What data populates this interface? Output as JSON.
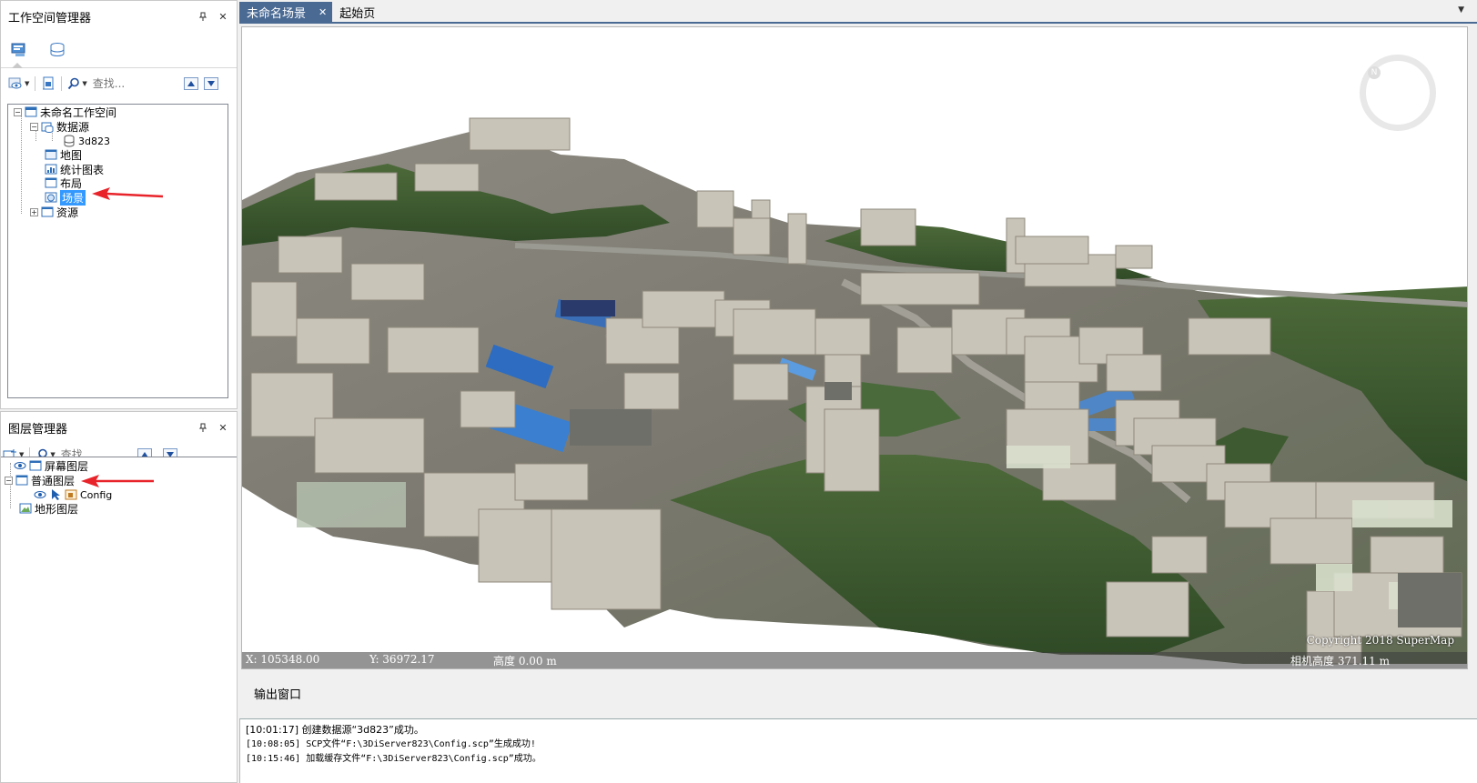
{
  "workspace_panel": {
    "title": "工作空间管理器",
    "pin": "ᴾ",
    "close": "✕",
    "search_placeholder": "查找...",
    "tree": {
      "root": "未命名工作空间",
      "datasources": "数据源",
      "datasource_item": "3d823",
      "map": "地图",
      "chart": "统计图表",
      "layout": "布局",
      "scene": "场景",
      "resources": "资源"
    }
  },
  "layer_panel": {
    "title": "图层管理器",
    "pin": "ᴾ",
    "close": "✕",
    "search_placeholder": "查找...",
    "tree": {
      "screen_layers": "屏幕图层",
      "normal_layers": "普通图层",
      "config_layer": "Config",
      "terrain_layers": "地形图层"
    }
  },
  "doc_tabs": {
    "active": "未命名场景",
    "close": "✕",
    "start_page": "起始页",
    "menu": "▼"
  },
  "scene": {
    "x_readout": "X: 105348.00",
    "y_readout": "Y: 36972.17",
    "altitude_readout": "高度 0.00 m",
    "copyright": "Copyright 2018 SuperMap",
    "camera_height": "相机高度 371.11 m"
  },
  "output": {
    "title": "输出窗口",
    "lines": [
      "[10:01:17] 创建数据源“3d823”成功。",
      "[10:08:05] SCP文件“F:\\3DiServer823\\Config.scp”生成成功!",
      "[10:15:46] 加载缓存文件“F:\\3DiServer823\\Config.scp”成功。"
    ]
  },
  "colors": {
    "selection": "#3399ff",
    "tab_active": "#4a6a94",
    "annotation_arrow": "#e8232a"
  }
}
